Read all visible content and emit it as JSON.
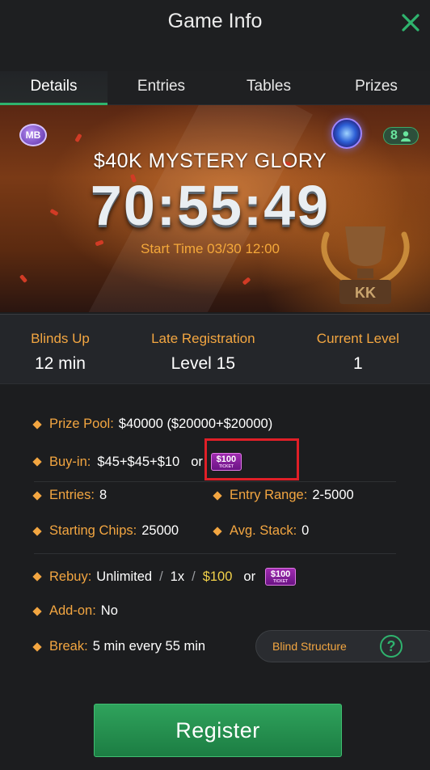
{
  "header": {
    "title": "Game Info",
    "close_icon": "close-x-icon",
    "accent": "#2fb36e"
  },
  "tabs": [
    {
      "label": "Details",
      "active": true
    },
    {
      "label": "Entries",
      "active": false
    },
    {
      "label": "Tables",
      "active": false
    },
    {
      "label": "Prizes",
      "active": false
    }
  ],
  "banner": {
    "badge": "MB",
    "player_count": "8",
    "title": "$40K MYSTERY GLORY",
    "countdown": "70:55:49",
    "start_time": "Start Time 03/30 12:00"
  },
  "stats": [
    {
      "label": "Blinds Up",
      "value": "12 min"
    },
    {
      "label": "Late Registration",
      "value": "Level 15"
    },
    {
      "label": "Current Level",
      "value": "1"
    }
  ],
  "info": {
    "prize_pool": {
      "label": "Prize Pool:",
      "value": "$40000 ($20000+$20000)"
    },
    "buy_in": {
      "label": "Buy-in:",
      "value": "$45+$45+$10",
      "or": "or",
      "ticket": "$100",
      "ticket_sub": "TICKET"
    },
    "entries": {
      "label": "Entries:",
      "value": "8"
    },
    "entry_range": {
      "label": "Entry Range:",
      "value": "2-5000"
    },
    "starting_chips": {
      "label": "Starting Chips:",
      "value": "25000"
    },
    "avg_stack": {
      "label": "Avg. Stack:",
      "value": "0"
    },
    "rebuy": {
      "label": "Rebuy:",
      "unlimited": "Unlimited",
      "slash1": "/",
      "count": "1x",
      "slash2": "/",
      "price": "$100",
      "or": "or",
      "ticket": "$100",
      "ticket_sub": "TICKET"
    },
    "addon": {
      "label": "Add-on:",
      "value": "No"
    },
    "break": {
      "label": "Break:",
      "value": "5 min every 55 min"
    }
  },
  "blind_structure": {
    "label": "Blind Structure",
    "icon": "help-question-icon"
  },
  "register": {
    "label": "Register"
  },
  "colors": {
    "label_orange": "#f3a641",
    "green": "#2fb36e",
    "highlight_red": "#e01f27"
  }
}
